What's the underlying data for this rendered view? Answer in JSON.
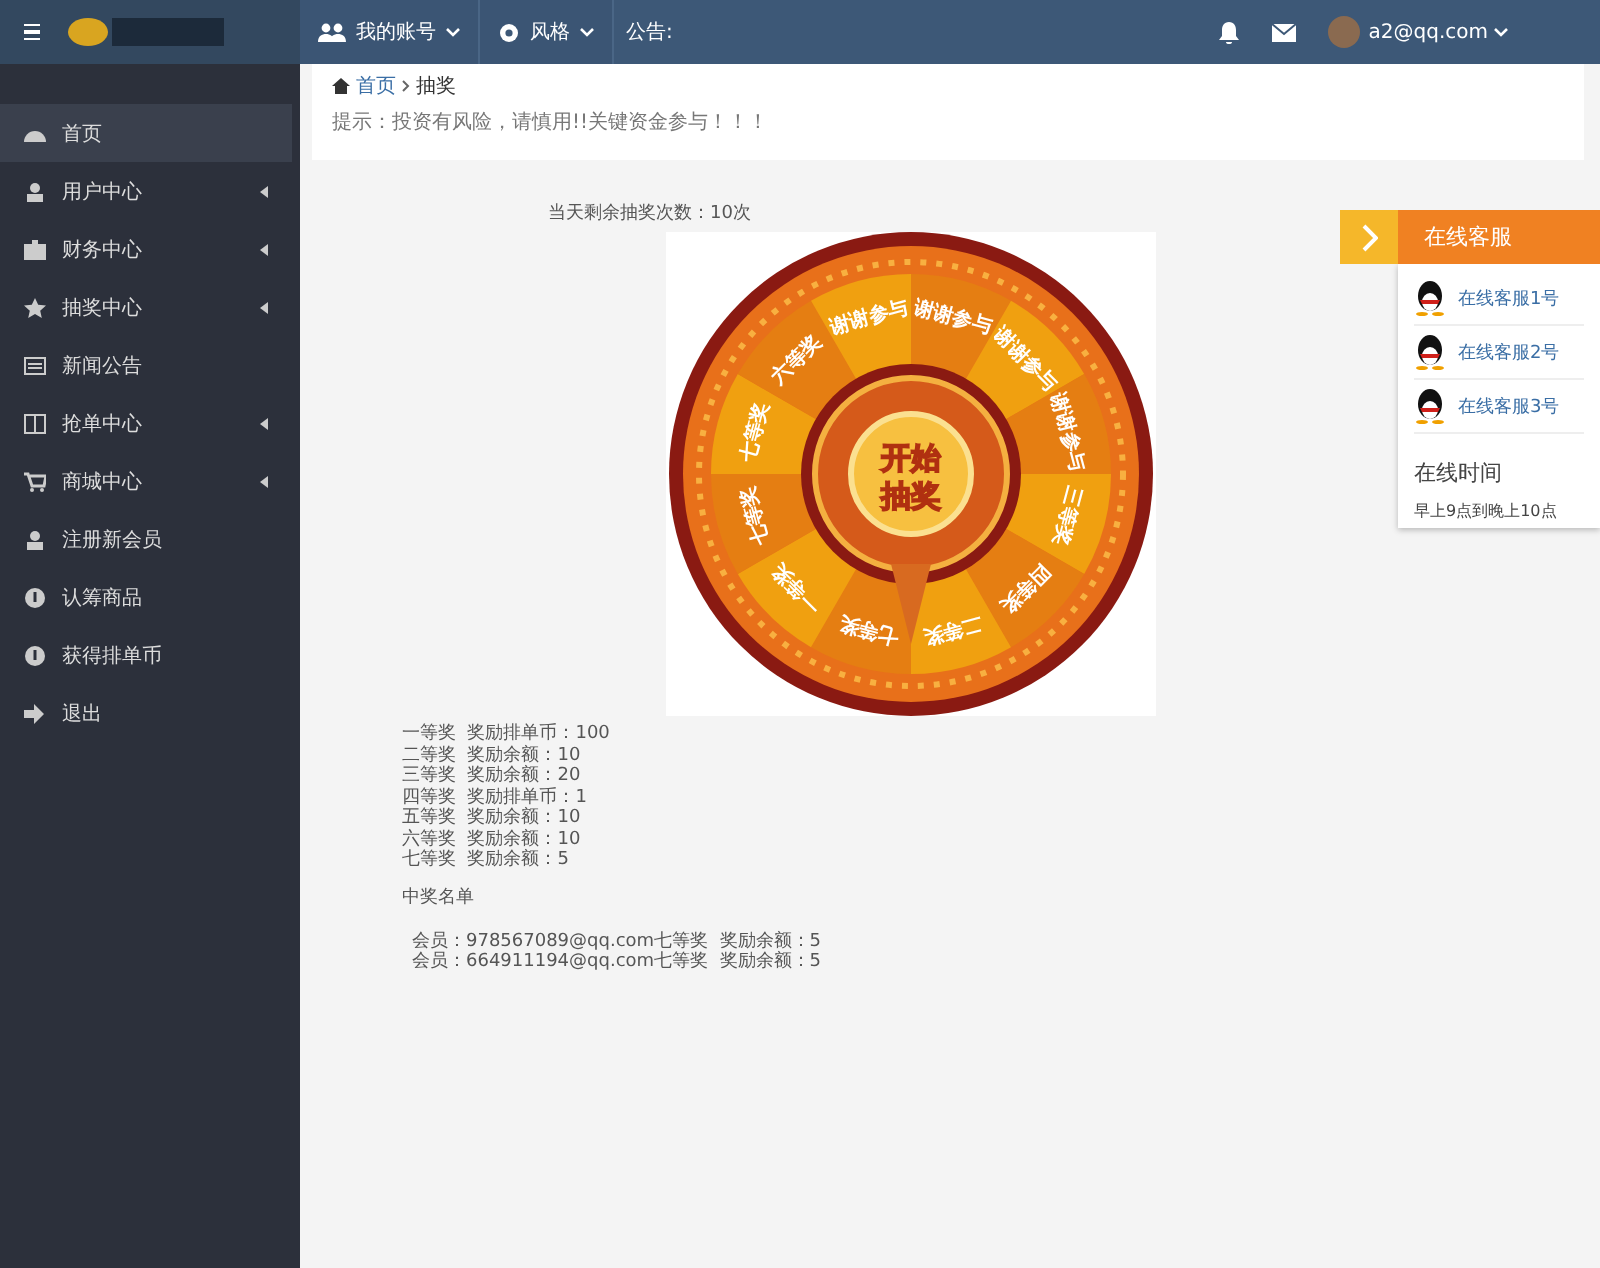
{
  "topbar": {
    "menus": [
      {
        "label": "我的账号"
      },
      {
        "label": "风格"
      }
    ],
    "notice": "公告:",
    "user": "a2@qq.com"
  },
  "sidebar": {
    "items": [
      {
        "label": "首页",
        "selected": true,
        "expandable": false
      },
      {
        "label": "用户中心",
        "selected": false,
        "expandable": true
      },
      {
        "label": "财务中心",
        "selected": false,
        "expandable": true
      },
      {
        "label": "抽奖中心",
        "selected": false,
        "expandable": true
      },
      {
        "label": "新闻公告",
        "selected": false,
        "expandable": false
      },
      {
        "label": "抢单中心",
        "selected": false,
        "expandable": true
      },
      {
        "label": "商城中心",
        "selected": false,
        "expandable": true
      },
      {
        "label": "注册新会员",
        "selected": false,
        "expandable": false
      },
      {
        "label": "认筹商品",
        "selected": false,
        "expandable": false
      },
      {
        "label": "获得排单币",
        "selected": false,
        "expandable": false
      },
      {
        "label": "退出",
        "selected": false,
        "expandable": false
      }
    ]
  },
  "breadcrumb": {
    "home": "首页",
    "current": "抽奖"
  },
  "tip": "提示：投资有风险，请慎用!!关键资金参与！！！",
  "remaining": "当天剩余抽奖次数：10次",
  "wheel": {
    "button": [
      "开始",
      "抽奖"
    ],
    "segments": [
      "谢谢参与",
      "谢谢参与",
      "谢谢参与",
      "三等奖",
      "四等奖",
      "二等奖",
      "七等奖",
      "一等奖",
      "七等奖",
      "七等奖",
      "六等奖",
      "谢谢参与"
    ]
  },
  "prizes": [
    {
      "name": "一等奖",
      "reward": "奖励排单币：100"
    },
    {
      "name": "二等奖",
      "reward": "奖励余额：10"
    },
    {
      "name": "三等奖",
      "reward": "奖励余额：20"
    },
    {
      "name": "四等奖",
      "reward": "奖励排单币：1"
    },
    {
      "name": "五等奖",
      "reward": "奖励余额：10"
    },
    {
      "name": "六等奖",
      "reward": "奖励余额：10"
    },
    {
      "name": "七等奖",
      "reward": "奖励余额：5"
    }
  ],
  "winners_title": "中奖名单",
  "winners": [
    "会员：978567089@qq.com七等奖  奖励余额：5",
    "会员：664911194@qq.com七等奖  奖励余额：5"
  ],
  "service": {
    "title": "在线客服",
    "agents": [
      "在线客服1号",
      "在线客服2号",
      "在线客服3号"
    ],
    "hours_title": "在线时间",
    "hours": "早上9点到晚上10点"
  }
}
